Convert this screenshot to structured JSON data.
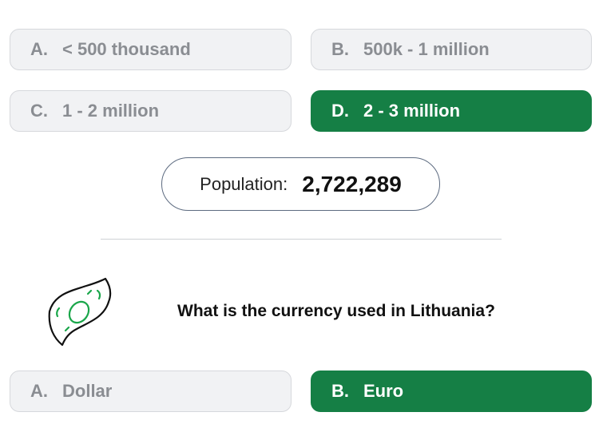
{
  "population_question": {
    "options": [
      {
        "letter": "A.",
        "text": "< 500 thousand",
        "selected": false
      },
      {
        "letter": "B.",
        "text": "500k - 1 million",
        "selected": false
      },
      {
        "letter": "C.",
        "text": "1 - 2 million",
        "selected": false
      },
      {
        "letter": "D.",
        "text": "2 - 3 million",
        "selected": true
      }
    ],
    "result_label": "Population:",
    "result_value": "2,722,289"
  },
  "currency_question": {
    "icon": "money-bill-icon",
    "question": "What is the currency used in Lithuania?",
    "options": [
      {
        "letter": "A.",
        "text": "Dollar",
        "selected": false
      },
      {
        "letter": "B.",
        "text": "Euro",
        "selected": true
      }
    ]
  },
  "colors": {
    "selected": "#157f45",
    "unselected_bg": "#f1f2f4",
    "unselected_text": "#8a8d92",
    "icon_accent": "#1aa64a"
  }
}
